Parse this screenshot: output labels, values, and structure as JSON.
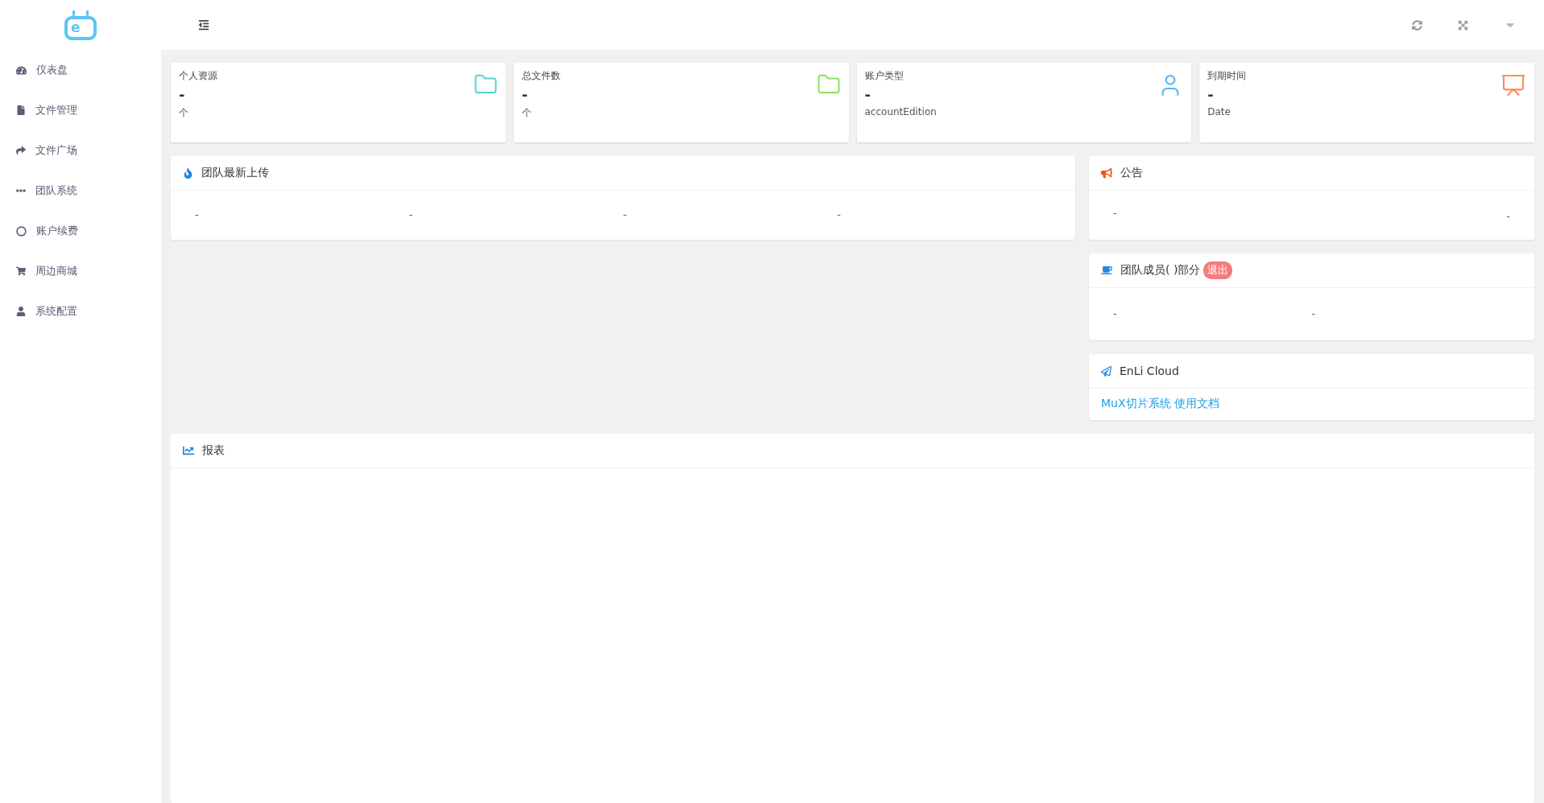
{
  "logo": {
    "letter": "e"
  },
  "sidebar": {
    "items": [
      {
        "label": "仪表盘",
        "kind": "dashboard"
      },
      {
        "label": "文件管理",
        "kind": "file"
      },
      {
        "label": "文件广场",
        "kind": "share"
      },
      {
        "label": "团队系统",
        "kind": "dots"
      },
      {
        "label": "账户续费",
        "kind": "ring"
      },
      {
        "label": "周边商城",
        "kind": "cart"
      },
      {
        "label": "系统配置",
        "kind": "user"
      }
    ]
  },
  "stats": [
    {
      "title": "个人资源",
      "value": "-",
      "unit": "个",
      "kind": "folder",
      "color": "#4fd6d6"
    },
    {
      "title": "总文件数",
      "value": "-",
      "unit": "个",
      "kind": "folder",
      "color": "#8ee05a"
    },
    {
      "title": "账户类型",
      "value": "-",
      "unit": "accountEdition",
      "kind": "user",
      "color": "#5bb5f5"
    },
    {
      "title": "到期时间",
      "value": "-",
      "unit": "Date",
      "kind": "presentation",
      "color": "#ff8c5a"
    }
  ],
  "uploads": {
    "title": "团队最新上传",
    "cells": [
      "-",
      "-",
      "-",
      "-"
    ]
  },
  "notice": {
    "title": "公告",
    "left": "-",
    "right": "-"
  },
  "members": {
    "title": "团队成员( )部分",
    "badge": "退出",
    "cells": [
      "-",
      "-"
    ]
  },
  "cloud": {
    "title": "EnLi Cloud",
    "link": "MuX切片系统 使用文档"
  },
  "report": {
    "title": "报表"
  }
}
